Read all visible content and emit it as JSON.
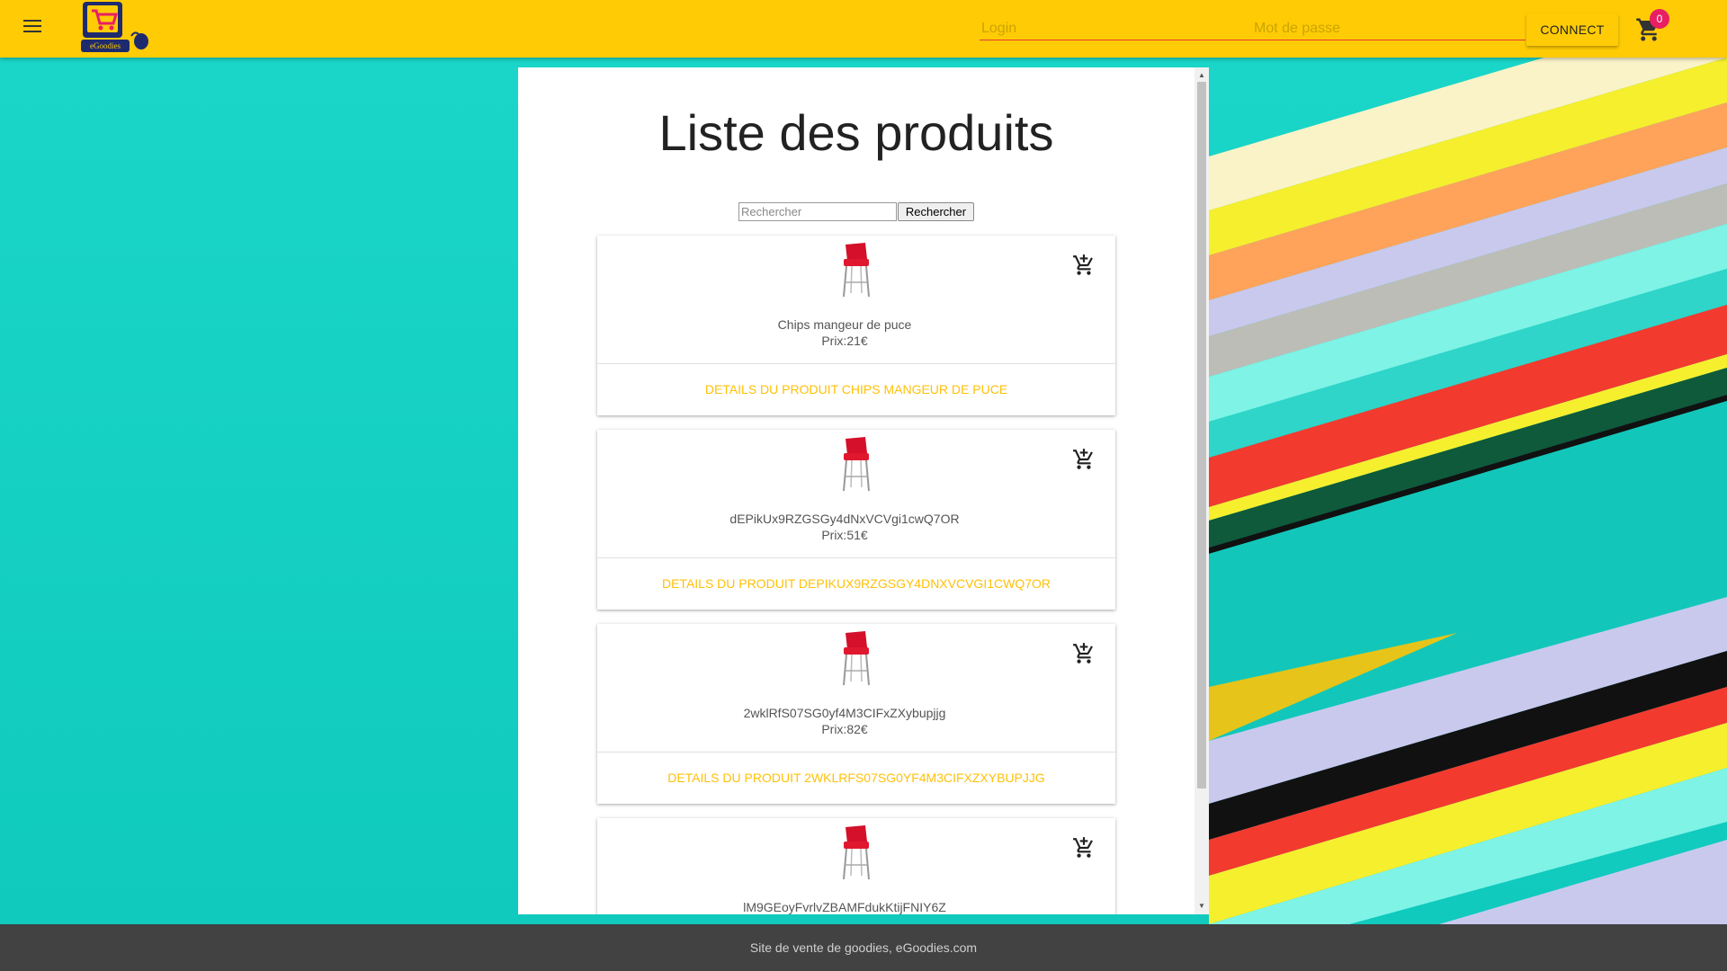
{
  "header": {
    "login_placeholder": "Login",
    "password_placeholder": "Mot de passe",
    "connect_label": "CONNECT",
    "cart_count": "0",
    "logo_text": "eGoodies"
  },
  "main": {
    "title": "Liste des produits",
    "search_placeholder": "Rechercher",
    "search_button": "Rechercher",
    "products": [
      {
        "name": "Chips mangeur de puce",
        "price": "Prix:21€",
        "details": "DETAILS DU PRODUIT CHIPS MANGEUR DE PUCE"
      },
      {
        "name": "dEPikUx9RZGSGy4dNxVCVgi1cwQ7OR",
        "price": "Prix:51€",
        "details": "DETAILS DU PRODUIT DEPIKUX9RZGSGY4DNXVCVGI1CWQ7OR"
      },
      {
        "name": "2wklRfS07SG0yf4M3CIFxZXybupjjg",
        "price": "Prix:82€",
        "details": "DETAILS DU PRODUIT 2WKLRFS07SG0YF4M3CIFXZXYBUPJJG"
      },
      {
        "name": "lM9GEoyFvrlvZBAMFdukKtijFNIY6Z",
        "price": "",
        "details": ""
      }
    ]
  },
  "footer": {
    "text": "Site de vente de goodies, eGoodies.com"
  },
  "colors": {
    "header": "#ffcb05",
    "accent_link": "#ffc107",
    "badge": "#e91e63",
    "footer": "#424242",
    "background": "#13cfc2"
  }
}
